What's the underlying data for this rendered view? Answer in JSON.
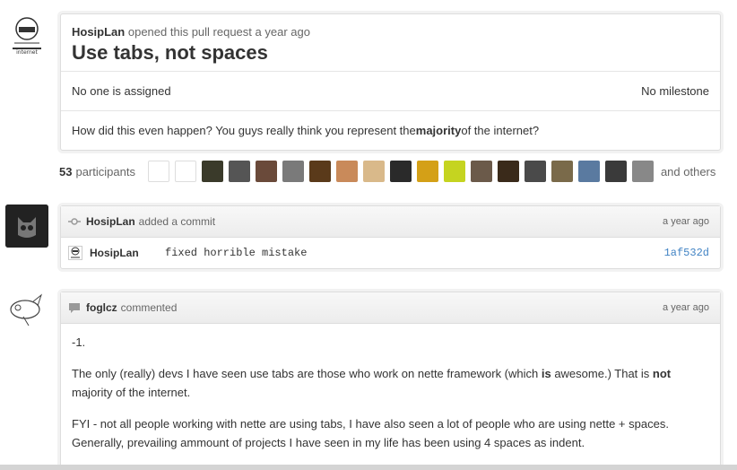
{
  "pull_request": {
    "author": "HosipLan",
    "meta_text": "opened this pull request a year ago",
    "title": "Use tabs, not spaces",
    "assignee": "No one is assigned",
    "milestone": "No milestone",
    "body_pre": "How did this even happen? You guys really think you represent the ",
    "body_bold": "majority",
    "body_post": " of the internet?"
  },
  "participants": {
    "count": "53",
    "label": "participants",
    "others": "and others",
    "avatar_colors": [
      "#ffffff",
      "#ffffff",
      "#3a3a2a",
      "#555555",
      "#6a4a3a",
      "#7a7a7a",
      "#5a3a1a",
      "#c98a5a",
      "#d9b98a",
      "#2a2a2a",
      "#d4a017",
      "#c5d420",
      "#6b5a4a",
      "#3a2a1a",
      "#4a4a4a",
      "#7a6a4a",
      "#5a7aa0",
      "#3a3a3a",
      "#888888"
    ]
  },
  "commit_event": {
    "author": "HosipLan",
    "action": "added a commit",
    "time": "a year ago",
    "commit_author": "HosipLan",
    "commit_message": "fixed horrible mistake",
    "commit_sha": "1af532d"
  },
  "comment": {
    "author": "foglcz",
    "action": "commented",
    "time": "a year ago",
    "p1": "-1.",
    "p2_a": "The only (really) devs I have seen use tabs are those who work on nette framework (which ",
    "p2_b": "is",
    "p2_c": " awesome.) That is ",
    "p2_d": "not",
    "p2_e": " majority of the internet.",
    "p3": "FYI - not all people working with nette are using tabs, I have also seen a lot of people who are using nette + spaces. Generally, prevailing ammount of projects I have seen in my life has been using 4 spaces as indent."
  }
}
